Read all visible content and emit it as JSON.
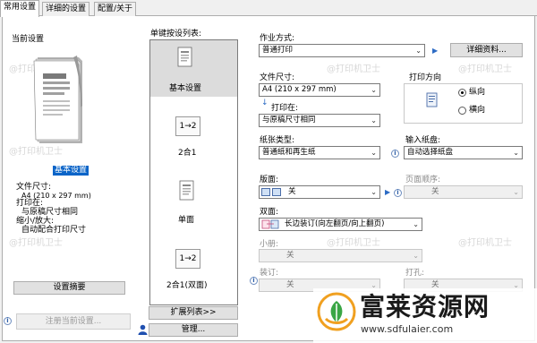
{
  "tabs": [
    {
      "label": "常用设置",
      "active": true
    },
    {
      "label": "详细的设置",
      "active": false
    },
    {
      "label": "配置/关于",
      "active": false
    }
  ],
  "current_settings": {
    "title": "当前设置",
    "selected_name": "基本设置",
    "lines": [
      "文件尺寸:",
      "A4 (210 x 297 mm)",
      "打印在:",
      "与原稿尺寸相同",
      "缩小/放大:",
      "自动配合打印尺寸"
    ],
    "summary_button": "设置摘要",
    "register_button": "注册当前设置..."
  },
  "preset_list": {
    "title": "单键按设列表:",
    "items": [
      {
        "label": "基本设置",
        "selected": true
      },
      {
        "label": "2合1",
        "icon_text": "1→2"
      },
      {
        "label": "单面"
      },
      {
        "label": "2合1(双面)",
        "icon_text": "1→2"
      }
    ],
    "expand_button": "扩展列表>>",
    "manage_button": "管理..."
  },
  "job": {
    "label": "作业方式:",
    "value": "普通打印",
    "details_button": "详细资料..."
  },
  "paper_size": {
    "label": "文件尺寸:",
    "value": "A4 (210 x 297 mm)"
  },
  "print_on": {
    "label": "打印在:",
    "value": "与原稿尺寸相同"
  },
  "orientation": {
    "title": "打印方向",
    "options": [
      {
        "label": "纵向",
        "checked": true
      },
      {
        "label": "横向",
        "checked": false
      }
    ]
  },
  "paper_type": {
    "label": "纸张类型:",
    "value": "普通纸和再生纸"
  },
  "input_tray": {
    "label": "输入纸盘:",
    "value": "自动选择纸盘"
  },
  "layout": {
    "label": "版面:",
    "value": "关"
  },
  "page_order": {
    "label": "页面顺序:",
    "value": "关"
  },
  "duplex": {
    "label": "双面:",
    "value": "长边装订(向左翻页/向上翻页)"
  },
  "booklet": {
    "label": "小册:",
    "value": "关"
  },
  "staple": {
    "label": "装订:",
    "value": "关"
  },
  "punch": {
    "label": "打孔:",
    "value": "关"
  },
  "watermarks": [
    "@打印机卫士",
    "@打印机卫士",
    "@打印机卫士",
    "@打印机卫士",
    "@打印机卫士",
    "@打印机卫士",
    "@打印机卫士",
    "@打印机卫士",
    "@打印机卫士",
    "@打印机卫士",
    "@打印机卫士",
    "@打印机卫士"
  ],
  "brand": {
    "name": "富莱资源网",
    "url": "www.sdfulaier.com"
  }
}
